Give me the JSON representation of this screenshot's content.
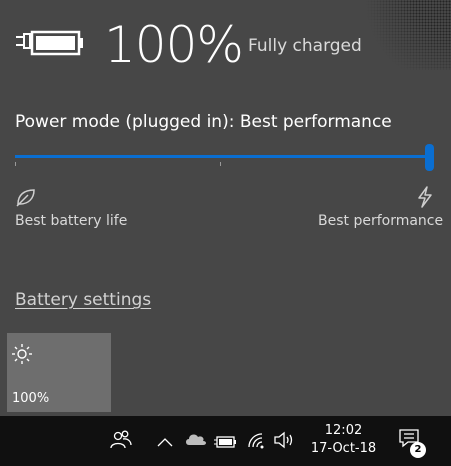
{
  "battery": {
    "percent": "100%",
    "status": "Fully charged",
    "icon": "battery-plugged-icon"
  },
  "power_mode": {
    "label": "Power mode (plugged in): Best performance",
    "level": 1.0,
    "left_caption": "Best battery life",
    "right_caption": "Best performance",
    "left_icon": "leaf-icon",
    "right_icon": "bolt-icon"
  },
  "links": {
    "battery_settings": "Battery settings"
  },
  "brightness_tile": {
    "icon": "brightness-icon",
    "value": "100%"
  },
  "taskbar": {
    "time": "12:02",
    "date": "17-Oct-18",
    "notification_count": "2"
  },
  "colors": {
    "flyout_bg": "#474747",
    "accent": "#0a6ed1",
    "tile_bg": "#6e6e6e",
    "taskbar_bg": "#101010"
  }
}
